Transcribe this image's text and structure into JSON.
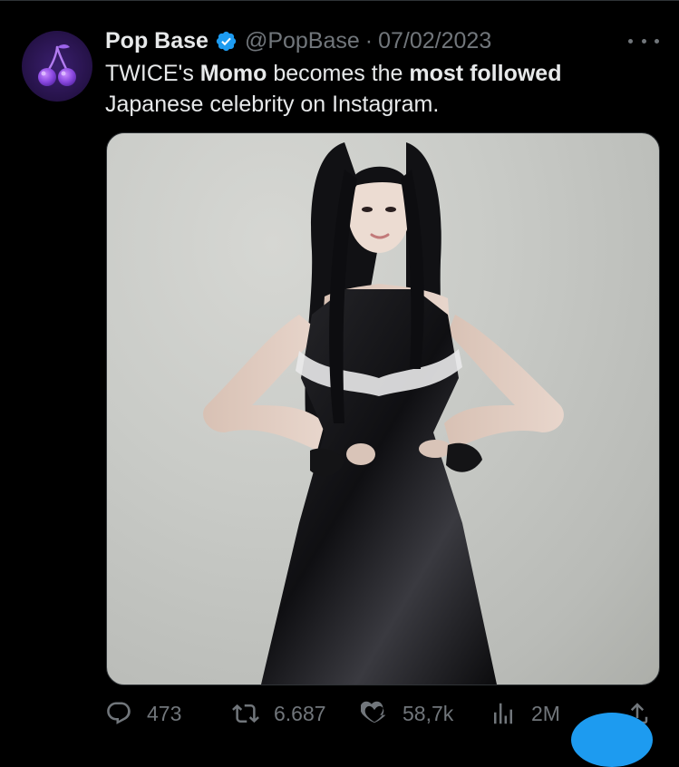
{
  "tweet": {
    "author": {
      "display_name": "Pop Base",
      "handle": "@PopBase",
      "verified": true,
      "avatar_icon": "cherry-icon"
    },
    "separator": "·",
    "date": "07/02/2023",
    "text": {
      "part1": "TWICE's ",
      "part2": "Momo",
      "part3": " becomes the ",
      "part4": "most followed",
      "part5": " Japanese celebrity on Instagram."
    },
    "actions": {
      "replies": "473",
      "retweets": "6.687",
      "likes": "58,7k",
      "views": "2M"
    }
  },
  "colors": {
    "background": "#000000",
    "text_primary": "#e7e9ea",
    "text_secondary": "#71767b",
    "verified_blue": "#1d9bf0",
    "divider": "#2f3336"
  }
}
